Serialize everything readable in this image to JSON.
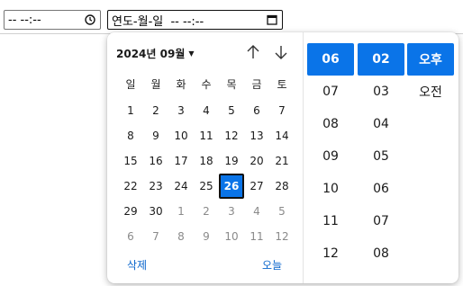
{
  "time_input": {
    "value": "-- --:--",
    "icon": "clock-icon"
  },
  "datetime_input": {
    "value": "연도-월-일  -- --:--",
    "icon": "calendar-icon"
  },
  "picker": {
    "month_label": "2024년 09월",
    "weekdays": [
      "일",
      "월",
      "화",
      "수",
      "목",
      "금",
      "토"
    ],
    "weeks": [
      [
        {
          "d": "1"
        },
        {
          "d": "2"
        },
        {
          "d": "3"
        },
        {
          "d": "4"
        },
        {
          "d": "5"
        },
        {
          "d": "6"
        },
        {
          "d": "7"
        }
      ],
      [
        {
          "d": "8"
        },
        {
          "d": "9"
        },
        {
          "d": "10"
        },
        {
          "d": "11"
        },
        {
          "d": "12"
        },
        {
          "d": "13"
        },
        {
          "d": "14"
        }
      ],
      [
        {
          "d": "15"
        },
        {
          "d": "16"
        },
        {
          "d": "17"
        },
        {
          "d": "18"
        },
        {
          "d": "19"
        },
        {
          "d": "20"
        },
        {
          "d": "21"
        }
      ],
      [
        {
          "d": "22"
        },
        {
          "d": "23"
        },
        {
          "d": "24"
        },
        {
          "d": "25"
        },
        {
          "d": "26",
          "selected": true
        },
        {
          "d": "27"
        },
        {
          "d": "28"
        }
      ],
      [
        {
          "d": "29"
        },
        {
          "d": "30"
        },
        {
          "d": "1",
          "other": true
        },
        {
          "d": "2",
          "other": true
        },
        {
          "d": "3",
          "other": true
        },
        {
          "d": "4",
          "other": true
        },
        {
          "d": "5",
          "other": true
        }
      ],
      [
        {
          "d": "6",
          "other": true
        },
        {
          "d": "7",
          "other": true
        },
        {
          "d": "8",
          "other": true
        },
        {
          "d": "9",
          "other": true
        },
        {
          "d": "10",
          "other": true
        },
        {
          "d": "11",
          "other": true
        },
        {
          "d": "12",
          "other": true
        }
      ]
    ],
    "delete_label": "삭제",
    "today_label": "오늘",
    "hours": [
      "06",
      "07",
      "08",
      "09",
      "10",
      "11",
      "12"
    ],
    "minutes": [
      "02",
      "03",
      "04",
      "05",
      "06",
      "07",
      "08"
    ],
    "ampm": [
      "오후",
      "오전"
    ],
    "accent_color": "#0a74e8"
  }
}
